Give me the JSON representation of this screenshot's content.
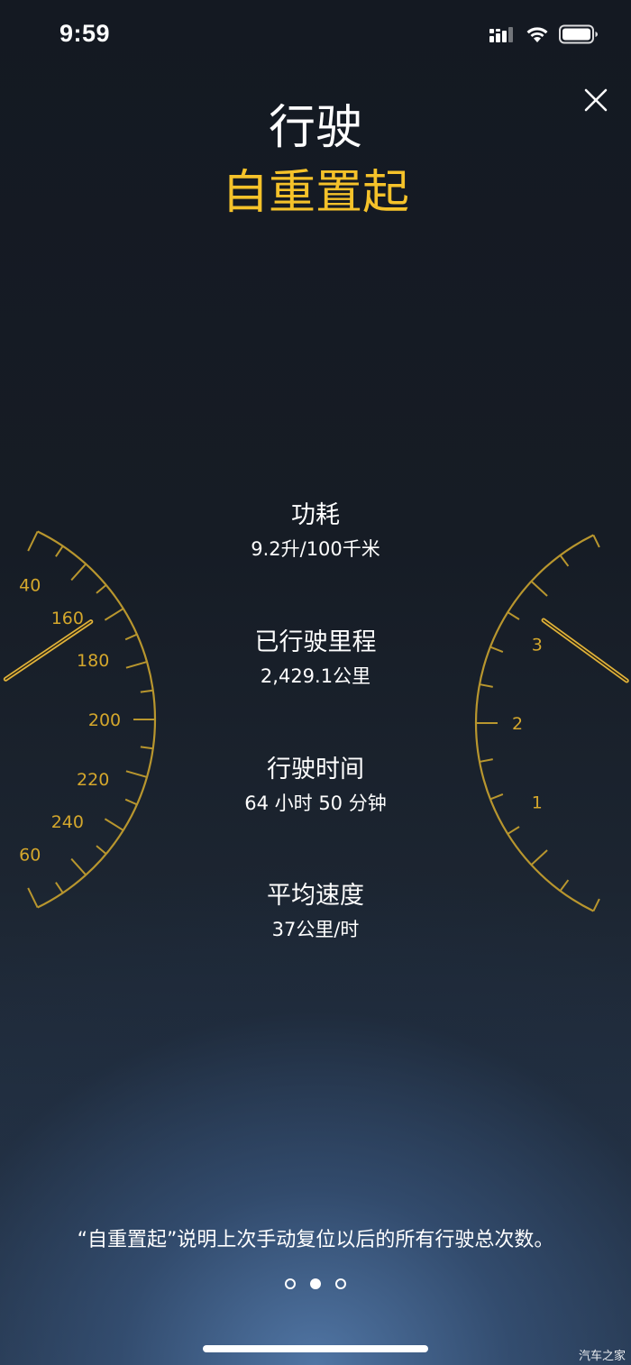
{
  "status_bar": {
    "time": "9:59"
  },
  "header": {
    "title": "行驶",
    "subtitle": "自重置起"
  },
  "stats": [
    {
      "label": "功耗",
      "value": "9.2升/100千米"
    },
    {
      "label": "已行驶里程",
      "value": "2,429.1公里"
    },
    {
      "label": "行驶时间",
      "value": "64 小时 50 分钟"
    },
    {
      "label": "平均速度",
      "value": "37公里/时"
    }
  ],
  "speedometer": {
    "tick_labels": [
      "40",
      "160",
      "180",
      "200",
      "220",
      "240",
      "60"
    ]
  },
  "tachometer": {
    "tick_labels": [
      "3",
      "2",
      "1"
    ]
  },
  "footnote": "“自重置起”说明上次手动复位以后的所有行驶总次数。",
  "pagination": {
    "total": 3,
    "current": 2
  },
  "watermark": "汽车之家",
  "colors": {
    "accent": "#f5c22a",
    "gauge": "#b8962e"
  }
}
